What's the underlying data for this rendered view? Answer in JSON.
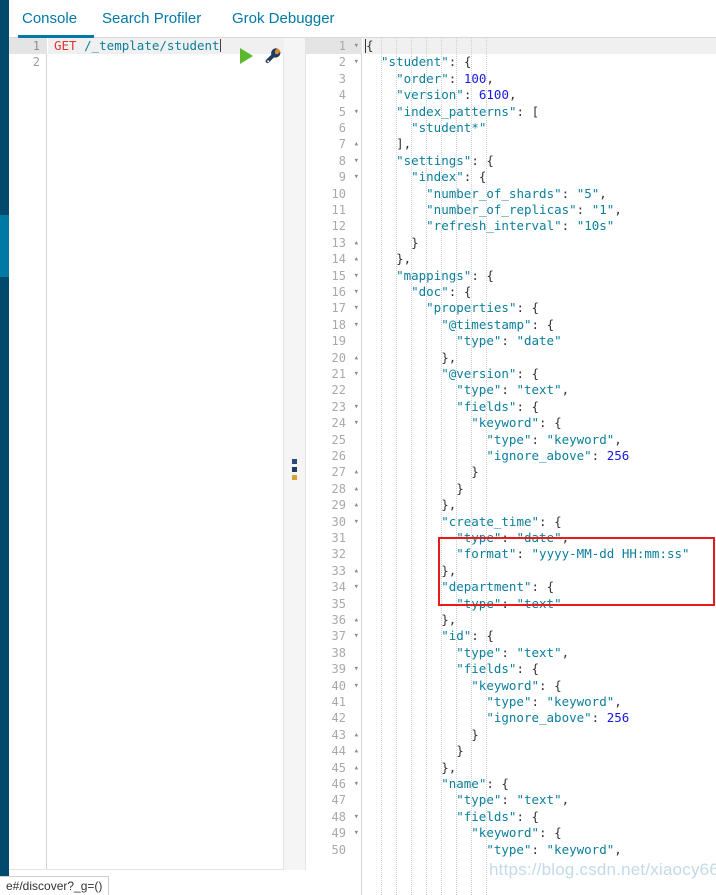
{
  "tabs": [
    {
      "id": "console",
      "label": "Console",
      "active": true
    },
    {
      "id": "search-profiler",
      "label": "Search Profiler",
      "active": false
    },
    {
      "id": "grok-debugger",
      "label": "Grok Debugger",
      "active": false
    }
  ],
  "request_editor": {
    "line_numbers": [
      "1",
      "2"
    ],
    "method": "GET",
    "path": "/_template/student",
    "play_button_label": "Send request",
    "wrench_button_label": "Request options"
  },
  "response_editor": {
    "lines": [
      {
        "n": "1",
        "fold": "▾",
        "indent": 0,
        "text": "{"
      },
      {
        "n": "2",
        "fold": "▾",
        "indent": 1,
        "text": "\"student\": {"
      },
      {
        "n": "3",
        "fold": "",
        "indent": 2,
        "text": "\"order\": 100,"
      },
      {
        "n": "4",
        "fold": "",
        "indent": 2,
        "text": "\"version\": 6100,"
      },
      {
        "n": "5",
        "fold": "▾",
        "indent": 2,
        "text": "\"index_patterns\": ["
      },
      {
        "n": "6",
        "fold": "",
        "indent": 3,
        "text": "\"student*\""
      },
      {
        "n": "7",
        "fold": "▴",
        "indent": 2,
        "text": "],"
      },
      {
        "n": "8",
        "fold": "▾",
        "indent": 2,
        "text": "\"settings\": {"
      },
      {
        "n": "9",
        "fold": "▾",
        "indent": 3,
        "text": "\"index\": {"
      },
      {
        "n": "10",
        "fold": "",
        "indent": 4,
        "text": "\"number_of_shards\": \"5\","
      },
      {
        "n": "11",
        "fold": "",
        "indent": 4,
        "text": "\"number_of_replicas\": \"1\","
      },
      {
        "n": "12",
        "fold": "",
        "indent": 4,
        "text": "\"refresh_interval\": \"10s\""
      },
      {
        "n": "13",
        "fold": "▴",
        "indent": 3,
        "text": "}"
      },
      {
        "n": "14",
        "fold": "▴",
        "indent": 2,
        "text": "},"
      },
      {
        "n": "15",
        "fold": "▾",
        "indent": 2,
        "text": "\"mappings\": {"
      },
      {
        "n": "16",
        "fold": "▾",
        "indent": 3,
        "text": "\"doc\": {"
      },
      {
        "n": "17",
        "fold": "▾",
        "indent": 4,
        "text": "\"properties\": {"
      },
      {
        "n": "18",
        "fold": "▾",
        "indent": 5,
        "text": "\"@timestamp\": {"
      },
      {
        "n": "19",
        "fold": "",
        "indent": 6,
        "text": "\"type\": \"date\""
      },
      {
        "n": "20",
        "fold": "▴",
        "indent": 5,
        "text": "},"
      },
      {
        "n": "21",
        "fold": "▾",
        "indent": 5,
        "text": "\"@version\": {"
      },
      {
        "n": "22",
        "fold": "",
        "indent": 6,
        "text": "\"type\": \"text\","
      },
      {
        "n": "23",
        "fold": "▾",
        "indent": 6,
        "text": "\"fields\": {"
      },
      {
        "n": "24",
        "fold": "▾",
        "indent": 7,
        "text": "\"keyword\": {"
      },
      {
        "n": "25",
        "fold": "",
        "indent": 8,
        "text": "\"type\": \"keyword\","
      },
      {
        "n": "26",
        "fold": "",
        "indent": 8,
        "text": "\"ignore_above\": 256"
      },
      {
        "n": "27",
        "fold": "▴",
        "indent": 7,
        "text": "}"
      },
      {
        "n": "28",
        "fold": "▴",
        "indent": 6,
        "text": "}"
      },
      {
        "n": "29",
        "fold": "▴",
        "indent": 5,
        "text": "},"
      },
      {
        "n": "30",
        "fold": "▾",
        "indent": 5,
        "text": "\"create_time\": {"
      },
      {
        "n": "31",
        "fold": "",
        "indent": 6,
        "text": "\"type\": \"date\","
      },
      {
        "n": "32",
        "fold": "",
        "indent": 6,
        "text": "\"format\": \"yyyy-MM-dd HH:mm:ss\""
      },
      {
        "n": "33",
        "fold": "▴",
        "indent": 5,
        "text": "},"
      },
      {
        "n": "34",
        "fold": "▾",
        "indent": 5,
        "text": "\"department\": {"
      },
      {
        "n": "35",
        "fold": "",
        "indent": 6,
        "text": "\"type\": \"text\""
      },
      {
        "n": "36",
        "fold": "▴",
        "indent": 5,
        "text": "},"
      },
      {
        "n": "37",
        "fold": "▾",
        "indent": 5,
        "text": "\"id\": {"
      },
      {
        "n": "38",
        "fold": "",
        "indent": 6,
        "text": "\"type\": \"text\","
      },
      {
        "n": "39",
        "fold": "▾",
        "indent": 6,
        "text": "\"fields\": {"
      },
      {
        "n": "40",
        "fold": "▾",
        "indent": 7,
        "text": "\"keyword\": {"
      },
      {
        "n": "41",
        "fold": "",
        "indent": 8,
        "text": "\"type\": \"keyword\","
      },
      {
        "n": "42",
        "fold": "",
        "indent": 8,
        "text": "\"ignore_above\": 256"
      },
      {
        "n": "43",
        "fold": "▴",
        "indent": 7,
        "text": "}"
      },
      {
        "n": "44",
        "fold": "▴",
        "indent": 6,
        "text": "}"
      },
      {
        "n": "45",
        "fold": "▴",
        "indent": 5,
        "text": "},"
      },
      {
        "n": "46",
        "fold": "▾",
        "indent": 5,
        "text": "\"name\": {"
      },
      {
        "n": "47",
        "fold": "",
        "indent": 6,
        "text": "\"type\": \"text\","
      },
      {
        "n": "48",
        "fold": "▾",
        "indent": 6,
        "text": "\"fields\": {"
      },
      {
        "n": "49",
        "fold": "▾",
        "indent": 7,
        "text": "\"keyword\": {"
      },
      {
        "n": "50",
        "fold": "",
        "indent": 8,
        "text": "\"type\": \"keyword\","
      }
    ]
  },
  "annotation": {
    "highlight_color": "#e81b1b",
    "highlighted_lines": [
      "30",
      "31",
      "32",
      "33"
    ]
  },
  "watermark": {
    "text": "https://blog.csdn.net/xiaocy66"
  },
  "statusbar": {
    "text": "e#/discover?_g=()"
  },
  "colors": {
    "accent": "#0079a5",
    "rail": "#014a6e",
    "rail_active": "#0079a5",
    "play": "#5cb82e",
    "method": "#d33333",
    "string": "#0b7f9b",
    "number": "#1a1ae6"
  }
}
